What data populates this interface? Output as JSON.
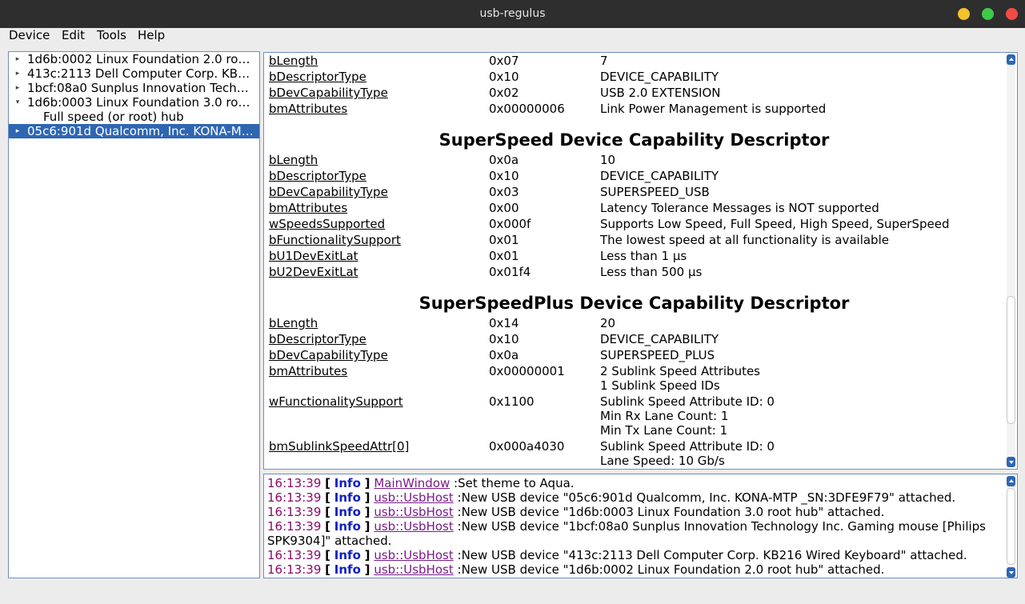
{
  "window": {
    "title": "usb-regulus",
    "colors": {
      "titlebar": "#2e2e2e",
      "minimize": "#f4c22b",
      "maximize": "#3fc94a",
      "close": "#f24b46",
      "selection": "#2f66b2"
    }
  },
  "menu": [
    "Device",
    "Edit",
    "Tools",
    "Help"
  ],
  "tree": [
    {
      "label": "1d6b:0002 Linux Foundation 2.0 ro…",
      "arrow": "▸"
    },
    {
      "label": "413c:2113 Dell Computer Corp. KB…",
      "arrow": "▸"
    },
    {
      "label": "1bcf:08a0 Sunplus Innovation Techn…",
      "arrow": "▸"
    },
    {
      "label": "1d6b:0003 Linux Foundation 3.0 ro…",
      "arrow": "▾"
    },
    {
      "label": "Full speed (or root) hub",
      "arrow": ""
    },
    {
      "label": "05c6:901d Qualcomm, Inc. KONA-M…",
      "arrow": "▸"
    }
  ],
  "details": {
    "usb2ext": [
      [
        "bLength",
        "0x07",
        "7"
      ],
      [
        "bDescriptorType",
        "0x10",
        "DEVICE_CAPABILITY"
      ],
      [
        "bDevCapabilityType",
        "0x02",
        "USB 2.0 EXTENSION"
      ],
      [
        "bmAttributes",
        "0x00000006",
        "Link Power Management is supported"
      ]
    ],
    "ss_title": "SuperSpeed Device Capability Descriptor",
    "ss": [
      [
        "bLength",
        "0x0a",
        "10"
      ],
      [
        "bDescriptorType",
        "0x10",
        "DEVICE_CAPABILITY"
      ],
      [
        "bDevCapabilityType",
        "0x03",
        "SUPERSPEED_USB"
      ],
      [
        "bmAttributes",
        "0x00",
        "Latency Tolerance Messages is NOT supported"
      ],
      [
        "wSpeedsSupported",
        "0x000f",
        "Supports Low Speed, Full Speed, High Speed, SuperSpeed"
      ],
      [
        "bFunctionalitySupport",
        "0x01",
        "The lowest speed at all functionality is available"
      ],
      [
        "bU1DevExitLat",
        "0x01",
        "Less than 1 µs"
      ],
      [
        "bU2DevExitLat",
        "0x01f4",
        "Less than 500 µs"
      ]
    ],
    "ssp_title": "SuperSpeedPlus Device Capability Descriptor",
    "ssp": [
      [
        "bLength",
        "0x14",
        "20"
      ],
      [
        "bDescriptorType",
        "0x10",
        "DEVICE_CAPABILITY"
      ],
      [
        "bDevCapabilityType",
        "0x0a",
        "SUPERSPEED_PLUS"
      ],
      [
        "bmAttributes",
        "0x00000001",
        "2 Sublink Speed Attributes"
      ],
      [
        "",
        "",
        "1 Sublink Speed IDs"
      ],
      [
        "wFunctionalitySupport",
        "0x1100",
        "Sublink Speed Attribute ID: 0"
      ],
      [
        "",
        "",
        "Min Rx Lane Count: 1"
      ],
      [
        "",
        "",
        "Min Tx Lane Count: 1"
      ],
      [
        "bmSublinkSpeedAttr[0]",
        "0x000a4030",
        "Sublink Speed Attribute ID: 0"
      ],
      [
        "",
        "",
        "Lane Speed: 10 Gb/s"
      ]
    ]
  },
  "log": [
    {
      "time": "16:13:39",
      "level": "Info",
      "source": "MainWindow",
      "message": ":Set theme to Aqua."
    },
    {
      "time": "16:13:39",
      "level": "Info",
      "source": "usb::UsbHost",
      "message": ":New USB device \"05c6:901d Qualcomm, Inc. KONA-MTP _SN:3DFE9F79\" attached."
    },
    {
      "time": "16:13:39",
      "level": "Info",
      "source": "usb::UsbHost",
      "message": ":New USB device \"1d6b:0003 Linux Foundation 3.0 root hub\" attached."
    },
    {
      "time": "16:13:39",
      "level": "Info",
      "source": "usb::UsbHost",
      "message": ":New USB device \"1bcf:08a0 Sunplus Innovation Technology Inc. Gaming mouse [Philips SPK9304]\" attached."
    },
    {
      "time": "16:13:39",
      "level": "Info",
      "source": "usb::UsbHost",
      "message": ":New USB device \"413c:2113 Dell Computer Corp. KB216 Wired Keyboard\" attached."
    },
    {
      "time": "16:13:39",
      "level": "Info",
      "source": "usb::UsbHost",
      "message": ":New USB device \"1d6b:0002 Linux Foundation 2.0 root hub\" attached."
    }
  ],
  "log_brackets": [
    "[",
    "]"
  ]
}
